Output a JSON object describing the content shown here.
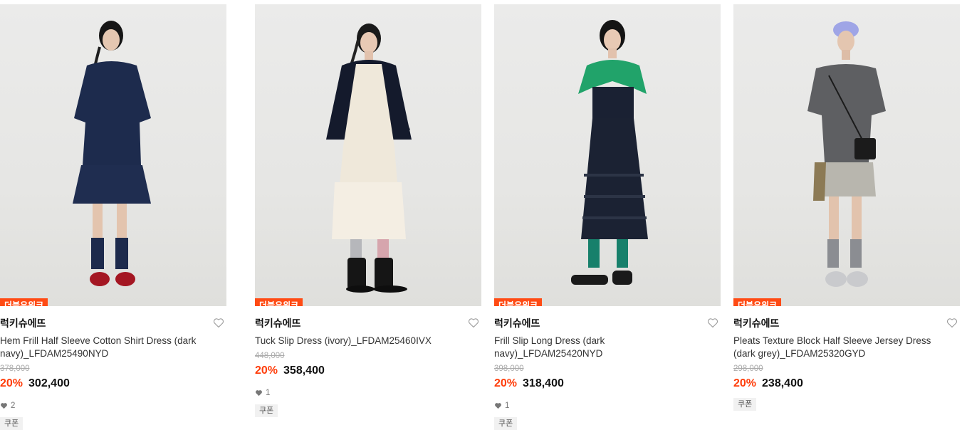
{
  "products": [
    {
      "badge": "더블유위크",
      "brand": "럭키슈에뜨",
      "name": "Tuck Slip Dress (ivory)_LFDAM25460IVX",
      "original_price": "448,000",
      "discount": "20%",
      "price": "358,400",
      "likes": "1",
      "coupon": "쿠폰"
    },
    {
      "badge": "더블유위크",
      "brand": "럭키슈에뜨",
      "name": "Frill Slip Long Dress (dark navy)_LFDAM25420NYD",
      "original_price": "398,000",
      "discount": "20%",
      "price": "318,400",
      "likes": "1",
      "coupon": "쿠폰"
    },
    {
      "badge": "더블유위크",
      "brand": "럭키슈에뜨",
      "name": "Pleats Texture Block Half Sleeve Jersey Dress (dark grey)_LFDAM25320GYD",
      "original_price": "298,000",
      "discount": "20%",
      "price": "238,400",
      "coupon": "쿠폰"
    },
    {
      "badge": "더블유위크",
      "brand": "럭키슈에뜨",
      "name": "Hem Frill Half Sleeve Cotton Shirt Dress (dark navy)_LFDAM25490NYD",
      "original_price": "378,000",
      "discount": "20%",
      "price": "302,400",
      "likes": "2",
      "coupon": "쿠폰"
    }
  ],
  "colors": {
    "badge": "#ff4b14",
    "discount": "#ff3d0a"
  },
  "icons": [
    "heart-outline-icon",
    "heart-filled-icon"
  ]
}
